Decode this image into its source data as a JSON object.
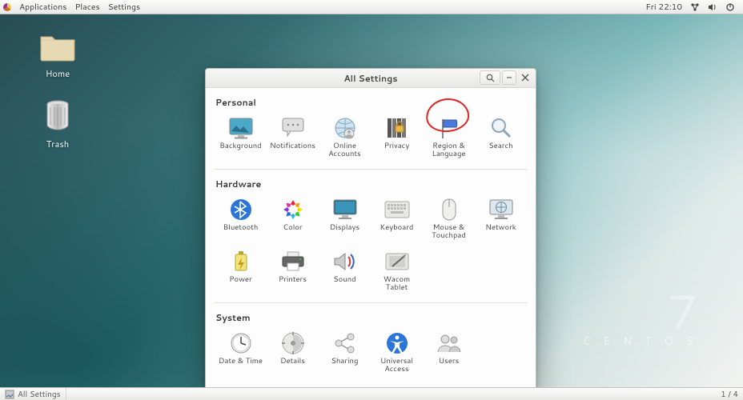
{
  "top_panel": {
    "menu": [
      "Applications",
      "Places",
      "Settings"
    ],
    "time": "Fri 22:10"
  },
  "desktop": {
    "home": "Home",
    "trash": "Trash"
  },
  "brand": {
    "version": "7",
    "name": "C E N T O S"
  },
  "bottom": {
    "task": "All Settings",
    "workspace": "1 / 4"
  },
  "window": {
    "title": "All Settings",
    "sections": {
      "personal": {
        "title": "Personal",
        "items": [
          {
            "name": "background",
            "label": "Background"
          },
          {
            "name": "notifications",
            "label": "Notifications"
          },
          {
            "name": "online-accounts",
            "label": "Online Accounts"
          },
          {
            "name": "privacy",
            "label": "Privacy"
          },
          {
            "name": "region-language",
            "label": "Region & Language"
          },
          {
            "name": "search",
            "label": "Search"
          }
        ]
      },
      "hardware": {
        "title": "Hardware",
        "items": [
          {
            "name": "bluetooth",
            "label": "Bluetooth"
          },
          {
            "name": "color",
            "label": "Color"
          },
          {
            "name": "displays",
            "label": "Displays"
          },
          {
            "name": "keyboard",
            "label": "Keyboard"
          },
          {
            "name": "mouse-touchpad",
            "label": "Mouse & Touchpad"
          },
          {
            "name": "network",
            "label": "Network"
          },
          {
            "name": "power",
            "label": "Power"
          },
          {
            "name": "printers",
            "label": "Printers"
          },
          {
            "name": "sound",
            "label": "Sound"
          },
          {
            "name": "wacom",
            "label": "Wacom Tablet"
          }
        ]
      },
      "system": {
        "title": "System",
        "items": [
          {
            "name": "date-time",
            "label": "Date & Time"
          },
          {
            "name": "details",
            "label": "Details"
          },
          {
            "name": "sharing",
            "label": "Sharing"
          },
          {
            "name": "universal-access",
            "label": "Universal Access"
          },
          {
            "name": "users",
            "label": "Users"
          }
        ]
      }
    }
  }
}
